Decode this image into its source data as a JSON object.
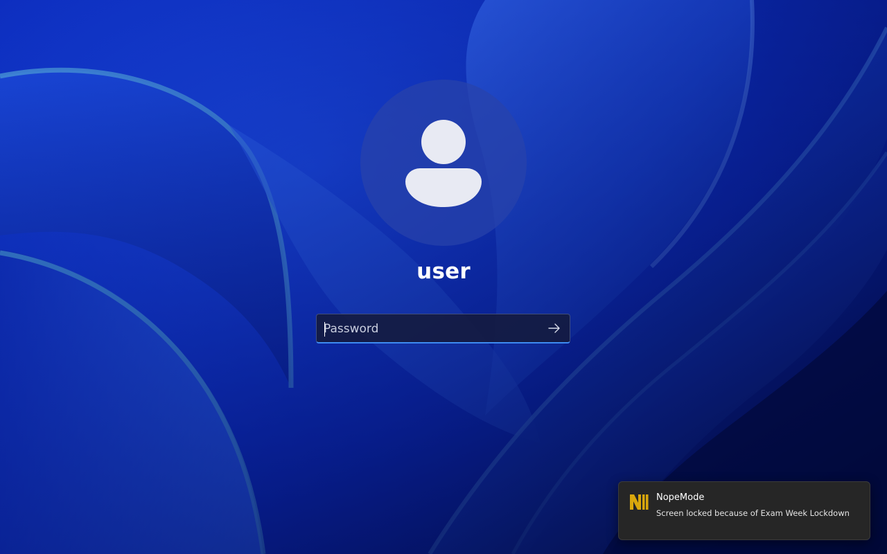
{
  "lock_screen": {
    "user": {
      "name": "user",
      "avatar_icon": "person-icon"
    },
    "password": {
      "placeholder": "Password",
      "value": "",
      "submit_icon": "arrow-right-icon",
      "accent_color": "#3d8bf2"
    },
    "wallpaper": {
      "theme": "blue-bloom",
      "colors": [
        "#0a2ab0",
        "#1541d8",
        "#2f6ae8",
        "#010a3a"
      ]
    }
  },
  "notification": {
    "app_name": "NopeMode",
    "app_icon": "nopemode-logo-icon",
    "message": "Screen locked because of Exam Week Lockdown",
    "logo_color": "#d9a70c",
    "background": "#262626"
  }
}
